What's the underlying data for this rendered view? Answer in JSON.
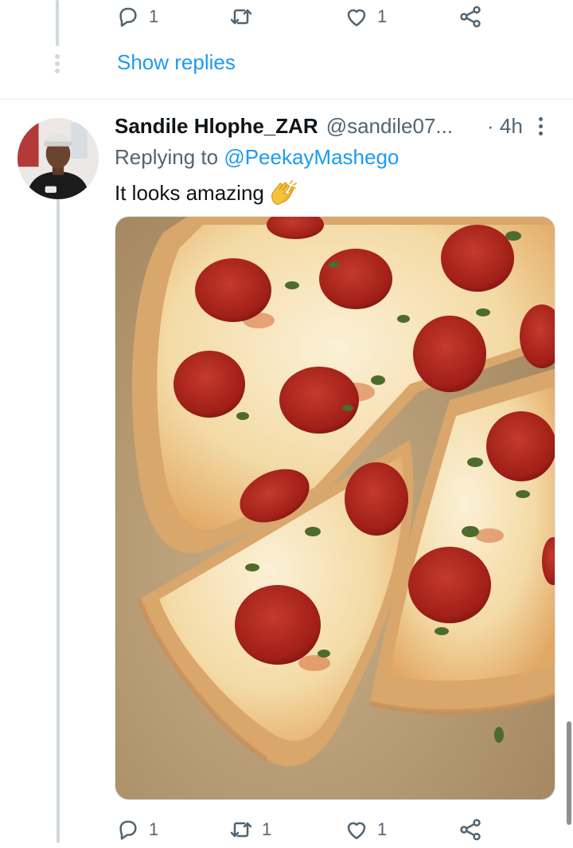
{
  "previous_tweet": {
    "actions": {
      "reply_count": "1",
      "retweet_count": "",
      "like_count": "1"
    },
    "show_replies_label": "Show replies"
  },
  "tweet": {
    "display_name": "Sandile Hlophe_ZAR",
    "handle": "@sandile07...",
    "time": "· 4h",
    "replying_prefix": "Replying to",
    "replying_to": "@PeekayMashego",
    "text": "It looks amazing",
    "emoji": "clapping-hands",
    "media": {
      "alt_subject": "pepperoni pizza with basil",
      "icon": "pizza-photo"
    },
    "actions": {
      "reply_count": "1",
      "retweet_count": "1",
      "like_count": "1"
    }
  },
  "colors": {
    "accent": "#1d9bf0",
    "muted": "#536471",
    "thread_line": "#cfd9de",
    "divider": "#eff3f4"
  },
  "icons": [
    "reply-icon",
    "retweet-icon",
    "like-icon",
    "share-icon",
    "more-icon"
  ]
}
